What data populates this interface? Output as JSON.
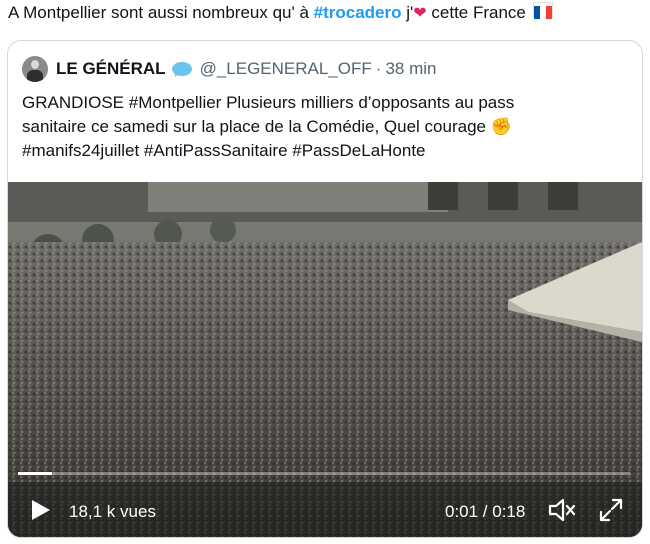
{
  "tweet": {
    "text_before": "A Montpellier sont aussi nombreux qu' à ",
    "hashtag": "#trocadero",
    "text_after_hashtag": " j'",
    "heart_emoji": "❤",
    "text_end": " cette France",
    "flag_colors": [
      "#0055a4",
      "#ffffff",
      "#ef4135"
    ]
  },
  "quote": {
    "author_name": "LE GÉNÉRAL",
    "handle": "@_LEGENERAL_OFF",
    "separator": "·",
    "time": "38 min",
    "verified_icon": "speech-bubble-icon",
    "lines": [
      "GRANDIOSE #Montpellier Plusieurs milliers d’opposants au pass",
      "sanitaire ce samedi sur la place de la Comédie, Quel courage ✊",
      "#manifs24juillet #AntiPassSanitaire #PassDeLaHonte"
    ]
  },
  "video": {
    "views": "18,1 k vues",
    "duration": "0:01 / 0:18",
    "progress": 0.056,
    "icons": [
      "play-icon",
      "volume-muted-icon",
      "fullscreen-icon"
    ]
  }
}
